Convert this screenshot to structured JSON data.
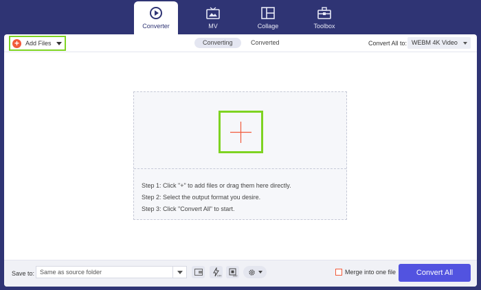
{
  "nav": {
    "tabs": [
      {
        "label": "Converter",
        "icon": "converter-icon",
        "active": true
      },
      {
        "label": "MV",
        "icon": "mv-icon",
        "active": false
      },
      {
        "label": "Collage",
        "icon": "collage-icon",
        "active": false
      },
      {
        "label": "Toolbox",
        "icon": "toolbox-icon",
        "active": false
      }
    ]
  },
  "toolbar": {
    "add_files_label": "Add Files",
    "segments": [
      "Converting",
      "Converted"
    ],
    "convert_all_to_label": "Convert All to:",
    "format_value": "WEBM 4K Video"
  },
  "dropzone": {
    "steps": [
      "Step 1: Click \"+\" to add files or drag them here directly.",
      "Step 2: Select the output format you desire.",
      "Step 3: Click \"Convert All\" to start."
    ]
  },
  "bottom": {
    "save_to_label": "Save to:",
    "save_path": "Same as source folder",
    "merge_label": "Merge into one file",
    "convert_all_label": "Convert All"
  },
  "colors": {
    "background": "#2f3474",
    "accent": "#5253e0",
    "highlight": "#7ed321",
    "add": "#f15a3a"
  }
}
